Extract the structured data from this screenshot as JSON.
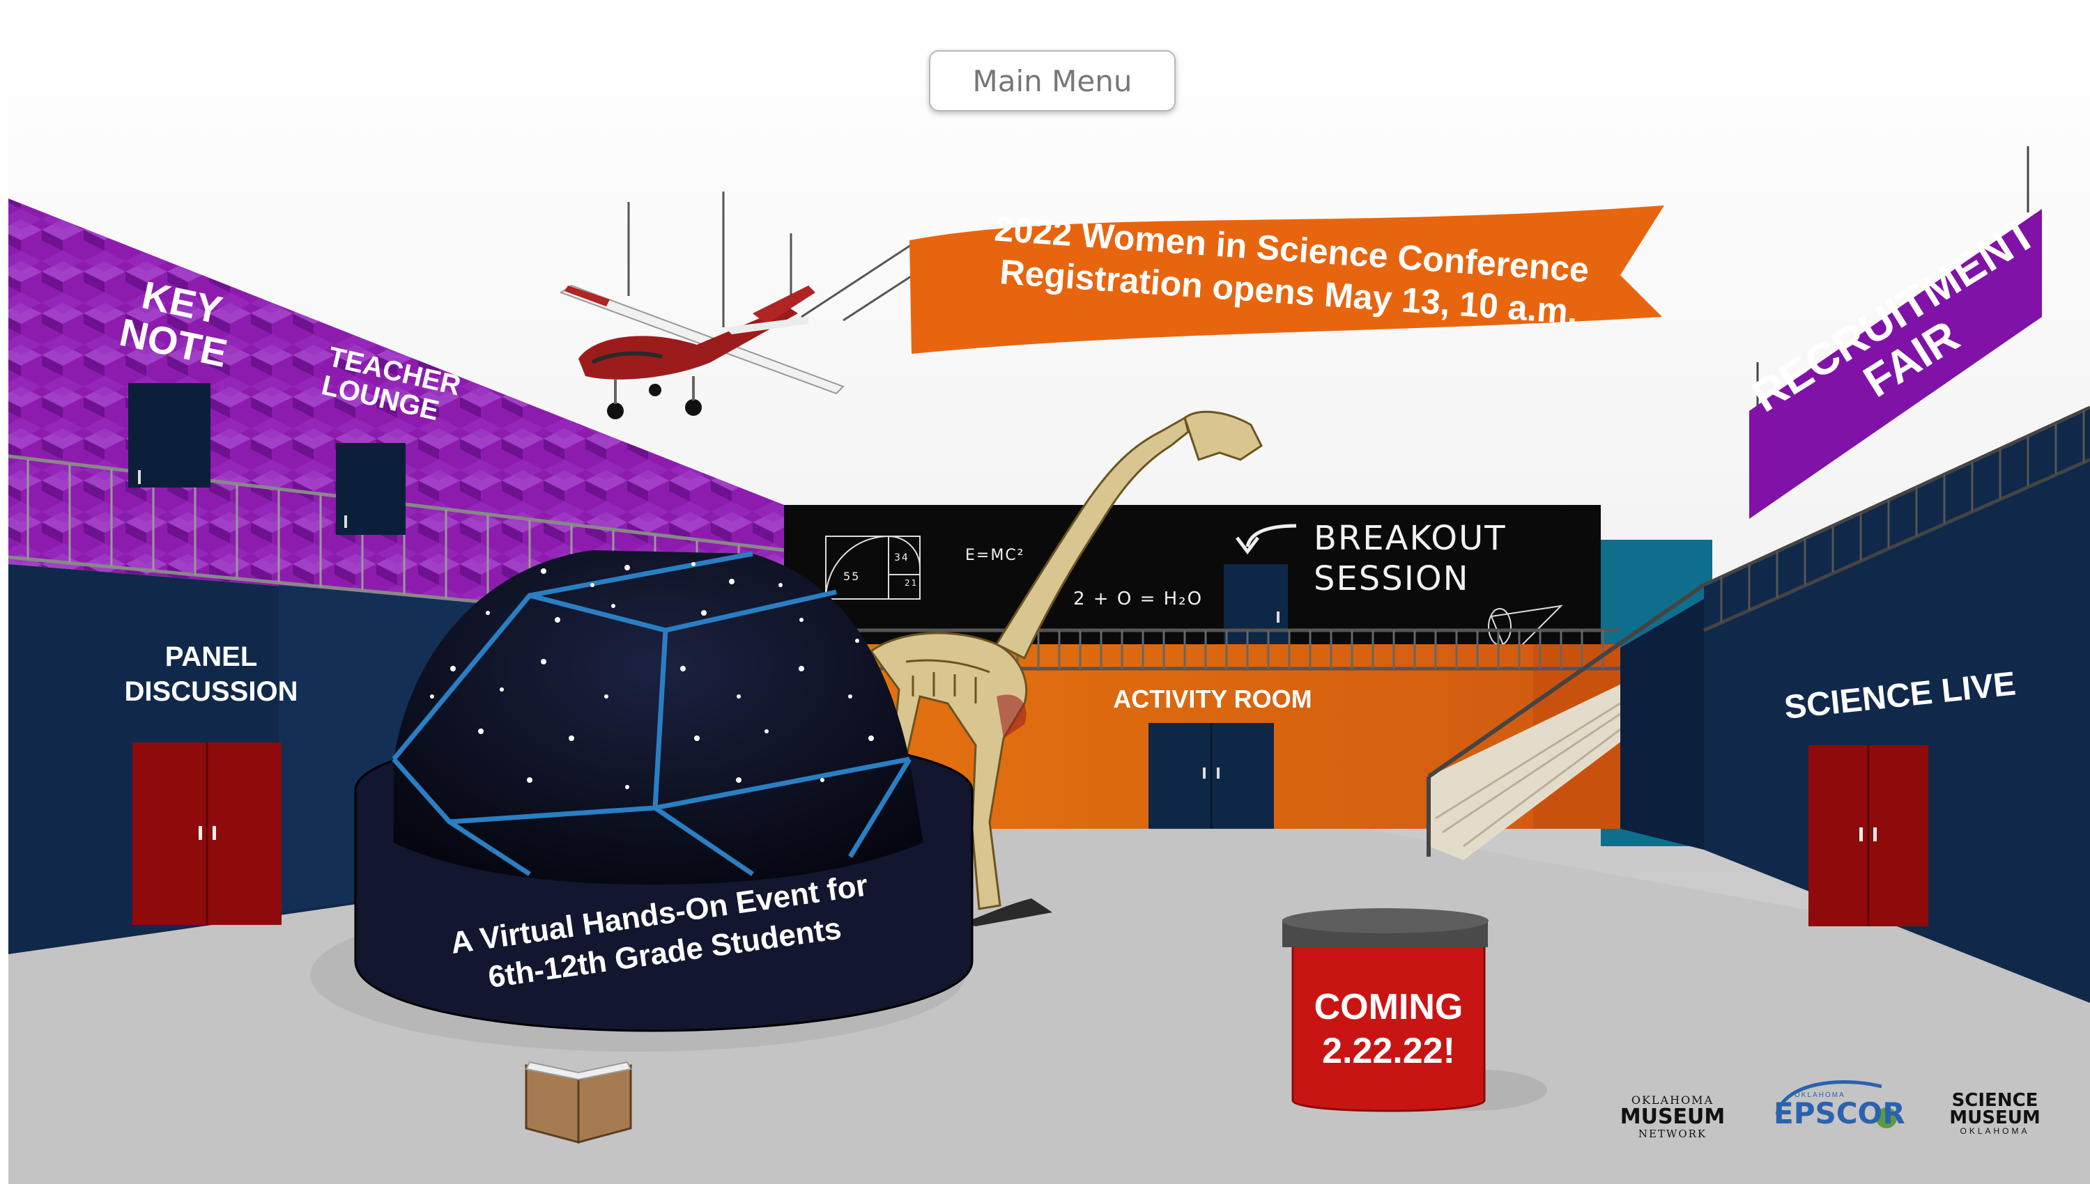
{
  "nav": {
    "main_menu": "Main Menu"
  },
  "banner": {
    "line1": "2022 Women in Science Conference",
    "line2": "Registration opens May 13, 10 a.m."
  },
  "rooms": {
    "keynote": [
      "KEY",
      "NOTE"
    ],
    "teacher_lounge": [
      "TEACHER",
      "LOUNGE"
    ],
    "panel_discussion": [
      "PANEL",
      "DISCUSSION"
    ],
    "activity_room": "ACTIVITY ROOM",
    "breakout_session": [
      "BREAKOUT",
      "SESSION"
    ],
    "recruitment_fair": [
      "RECRUITMENT",
      "FAIR"
    ],
    "science_live": "SCIENCE LIVE"
  },
  "chalkboard": {
    "formula1": "E=MC²",
    "formula2": "2 + O = H₂O",
    "fib_a": "55",
    "fib_b": "34",
    "fib_c": "21"
  },
  "dome": {
    "line1": "A Virtual Hands-On Event for",
    "line2": "6th-12th Grade Students"
  },
  "kiosk": {
    "line1": "COMING",
    "line2": "2.22.22!"
  },
  "logos": {
    "museum_top": "OKLAHOMA",
    "museum_main": "MUSEUM",
    "museum_bottom": "NETWORK",
    "epscor_top": "OKLAHOMA",
    "epscor_main": "EPSCOR",
    "science_main1": "SCIENCE",
    "science_main2": "MUSEUM",
    "science_bottom": "OKLAHOMA"
  },
  "colors": {
    "banner": "#e8650f",
    "purple": "#8b1aa8",
    "navy": "#0f2747",
    "orange": "#e8700c",
    "door_red": "#9b0d0d",
    "kiosk_red": "#cc1111"
  }
}
